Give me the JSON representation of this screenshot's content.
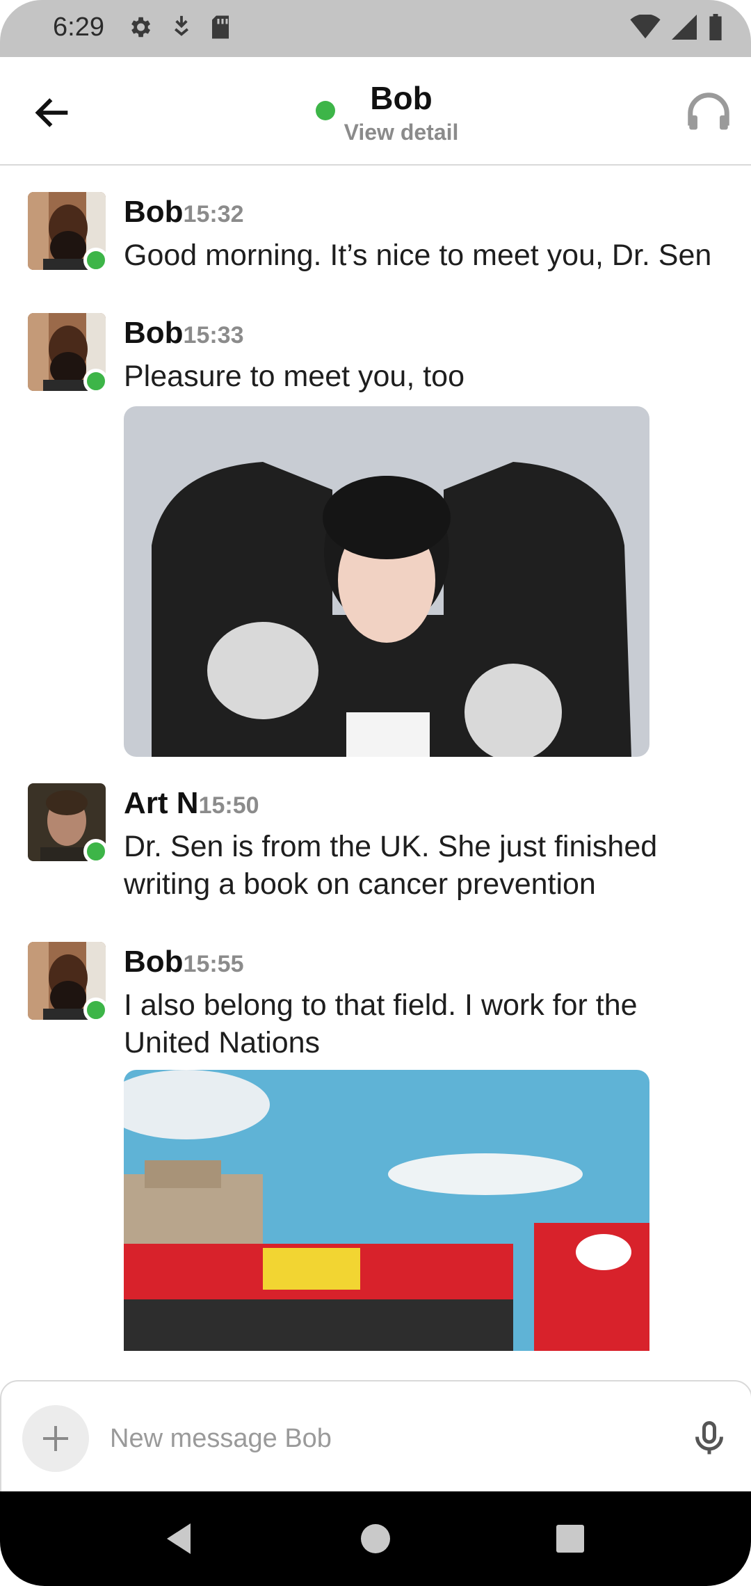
{
  "status_bar": {
    "time": "6:29",
    "left_icons": [
      "gear-icon",
      "download-icon",
      "sd-card-icon"
    ],
    "right_icons": [
      "wifi-icon",
      "signal-icon",
      "battery-icon"
    ]
  },
  "header": {
    "title": "Bob",
    "subtitle": "View detail",
    "online_color": "#3db548"
  },
  "messages": [
    {
      "sender": "Bob",
      "time": "15:32",
      "text": "Good morning. It’s nice to meet you, Dr. Sen",
      "avatar": "bob-avatar"
    },
    {
      "sender": "Bob",
      "time": "15:33",
      "text": "Pleasure to meet you, too",
      "avatar": "bob-avatar",
      "image": "woman-in-varsity-jacket-photo"
    },
    {
      "sender": "Art N",
      "time": "15:50",
      "text": "Dr. Sen is from the UK. She just finished writing a book on cancer prevention",
      "avatar": "art-avatar"
    },
    {
      "sender": "Bob",
      "time": "15:55",
      "text": "I also belong to that field. I work for the United Nations",
      "avatar": "bob-avatar",
      "image": "red-sightseeing-bus-photo"
    }
  ],
  "composer": {
    "placeholder": "New message Bob"
  },
  "colors": {
    "accent_green": "#3db548",
    "muted_text": "#8b8b8b"
  }
}
